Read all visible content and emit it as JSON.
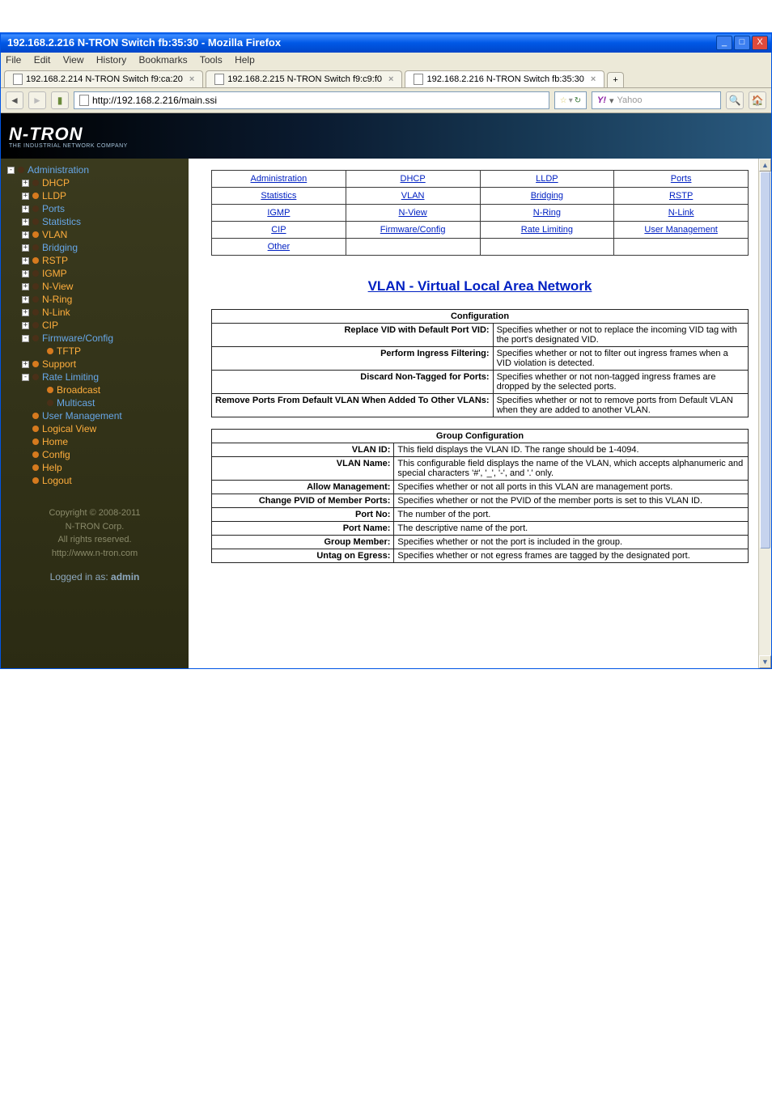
{
  "window": {
    "title": "192.168.2.216 N-TRON Switch fb:35:30 - Mozilla Firefox"
  },
  "menu": {
    "file": "File",
    "edit": "Edit",
    "view": "View",
    "history": "History",
    "bookmarks": "Bookmarks",
    "tools": "Tools",
    "help": "Help"
  },
  "tabs": [
    {
      "label": "192.168.2.214 N-TRON Switch f9:ca:20"
    },
    {
      "label": "192.168.2.215 N-TRON Switch f9:c9:f0"
    },
    {
      "label": "192.168.2.216 N-TRON Switch fb:35:30"
    }
  ],
  "url": "http://192.168.2.216/main.ssi",
  "search_placeholder": "Yahoo",
  "logo": {
    "main": "N-TRON",
    "sub": "THE INDUSTRIAL NETWORK COMPANY"
  },
  "sidebar": {
    "items": [
      {
        "l": 1,
        "ex": "-",
        "b": "dark",
        "label": "Administration",
        "c": "blue"
      },
      {
        "l": 2,
        "ex": "+",
        "b": "dark",
        "label": "DHCP",
        "c": "hot"
      },
      {
        "l": 2,
        "ex": "+",
        "b": "orange",
        "label": "LLDP",
        "c": "hot"
      },
      {
        "l": 2,
        "ex": "+",
        "b": "dark",
        "label": "Ports",
        "c": "blue"
      },
      {
        "l": 2,
        "ex": "+",
        "b": "dark",
        "label": "Statistics",
        "c": "blue"
      },
      {
        "l": 2,
        "ex": "+",
        "b": "orange",
        "label": "VLAN",
        "c": "hot"
      },
      {
        "l": 2,
        "ex": "+",
        "b": "dark",
        "label": "Bridging",
        "c": "blue"
      },
      {
        "l": 2,
        "ex": "+",
        "b": "orange",
        "label": "RSTP",
        "c": "hot"
      },
      {
        "l": 2,
        "ex": "+",
        "b": "dark",
        "label": "IGMP",
        "c": "hot"
      },
      {
        "l": 2,
        "ex": "+",
        "b": "dark",
        "label": "N-View",
        "c": "hot"
      },
      {
        "l": 2,
        "ex": "+",
        "b": "dark",
        "label": "N-Ring",
        "c": "hot"
      },
      {
        "l": 2,
        "ex": "+",
        "b": "dark",
        "label": "N-Link",
        "c": "hot"
      },
      {
        "l": 2,
        "ex": "+",
        "b": "dark",
        "label": "CIP",
        "c": "hot"
      },
      {
        "l": 2,
        "ex": "-",
        "b": "dark",
        "label": "Firmware/Config",
        "c": "blue"
      },
      {
        "l": 3,
        "ex": "",
        "b": "orange",
        "label": "TFTP",
        "c": "hot"
      },
      {
        "l": 2,
        "ex": "+",
        "b": "orange",
        "label": "Support",
        "c": "hot"
      },
      {
        "l": 2,
        "ex": "-",
        "b": "dark",
        "label": "Rate Limiting",
        "c": "blue"
      },
      {
        "l": 3,
        "ex": "",
        "b": "orange",
        "label": "Broadcast",
        "c": "hot"
      },
      {
        "l": 3,
        "ex": "",
        "b": "dark",
        "label": "Multicast",
        "c": "blue"
      },
      {
        "l": 2,
        "ex": "",
        "b": "orange",
        "label": "User Management",
        "c": "blue"
      },
      {
        "l": 2,
        "ex": "",
        "b": "orange",
        "label": "Logical View",
        "c": "hot"
      },
      {
        "l": 2,
        "ex": "",
        "b": "orange",
        "label": "Home",
        "c": "hot"
      },
      {
        "l": 2,
        "ex": "",
        "b": "orange",
        "label": "Config",
        "c": "hot"
      },
      {
        "l": 2,
        "ex": "",
        "b": "orange",
        "label": "Help",
        "c": "hot"
      },
      {
        "l": 2,
        "ex": "",
        "b": "orange",
        "label": "Logout",
        "c": "hot"
      }
    ],
    "copyright_line1": "Copyright © 2008-2011",
    "copyright_line2": "N-TRON Corp.",
    "copyright_line3": "All rights reserved.",
    "copyright_link": "http://www.n-tron.com",
    "logged_in": "Logged in as: ",
    "logged_user": "admin"
  },
  "link_grid": [
    [
      "Administration",
      "DHCP",
      "LLDP",
      "Ports"
    ],
    [
      "Statistics",
      "VLAN",
      "Bridging",
      "RSTP"
    ],
    [
      "IGMP",
      "N-View",
      "N-Ring",
      "N-Link"
    ],
    [
      "CIP",
      "Firmware/Config",
      "Rate Limiting",
      "User Management"
    ],
    [
      "Other",
      "",
      "",
      ""
    ]
  ],
  "page_title": "VLAN - Virtual Local Area Network",
  "config_table": {
    "header": "Configuration",
    "rows": [
      {
        "k": "Replace VID with Default Port VID:",
        "v": "Specifies whether or not to replace the incoming VID tag with the port's designated VID."
      },
      {
        "k": "Perform Ingress Filtering:",
        "v": "Specifies whether or not to filter out ingress frames when a VID violation is detected."
      },
      {
        "k": "Discard Non-Tagged for Ports:",
        "v": "Specifies whether or not non-tagged ingress frames are dropped by the selected ports."
      },
      {
        "k": "Remove Ports From Default VLAN When Added To Other VLANs:",
        "v": "Specifies whether or not to remove ports from Default VLAN when they are added to another VLAN."
      }
    ]
  },
  "group_table": {
    "header": "Group Configuration",
    "rows": [
      {
        "k": "VLAN ID:",
        "v": "This field displays the VLAN ID. The range should be 1-4094."
      },
      {
        "k": "VLAN Name:",
        "v": "This configurable field displays the name of the VLAN, which accepts alphanumeric and special characters '#', '_', '-', and '.' only."
      },
      {
        "k": "Allow Management:",
        "v": "Specifies whether or not all ports in this VLAN are management ports."
      },
      {
        "k": "Change PVID of Member Ports:",
        "v": "Specifies whether or not the PVID of the member ports is set to this VLAN ID."
      },
      {
        "k": "Port No:",
        "v": "The number of the port."
      },
      {
        "k": "Port Name:",
        "v": "The descriptive name of the port."
      },
      {
        "k": "Group Member:",
        "v": "Specifies whether or not the port is included in the group."
      },
      {
        "k": "Untag on Egress:",
        "v": "Specifies whether or not egress frames are tagged by the designated port."
      }
    ]
  }
}
